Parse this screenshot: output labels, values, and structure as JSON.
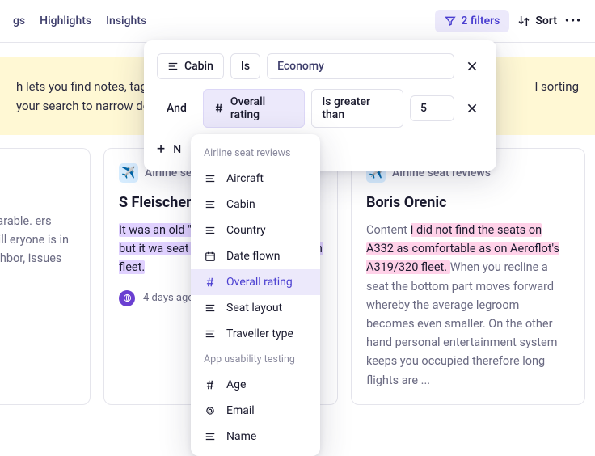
{
  "toolbar": {
    "tabs": [
      "gs",
      "Highlights",
      "Insights"
    ],
    "filters_label": "2 filters",
    "sort_label": "Sort"
  },
  "banner": {
    "line1": "h lets you find notes, tags,",
    "line2": "your search to narrow dow",
    "line3_suffix": "l sorting"
  },
  "filters": {
    "row1": {
      "field_label": "Cabin",
      "operator": "Is",
      "value": "Economy"
    },
    "row2": {
      "conj": "And",
      "field_label": "Overall rating",
      "operator": "Is greater than",
      "value": "5"
    },
    "new_filter_label": "N"
  },
  "dropdown": {
    "groups": [
      {
        "label": "Airline seat reviews",
        "items": [
          {
            "icon": "text",
            "label": "Aircraft"
          },
          {
            "icon": "text",
            "label": "Cabin"
          },
          {
            "icon": "text",
            "label": "Country"
          },
          {
            "icon": "date",
            "label": "Date flown"
          },
          {
            "icon": "number",
            "label": "Overall rating",
            "selected": true
          },
          {
            "icon": "text",
            "label": "Seat layout"
          },
          {
            "icon": "text",
            "label": "Traveller type"
          }
        ]
      },
      {
        "label": "App usability testing",
        "items": [
          {
            "icon": "number",
            "label": "Age"
          },
          {
            "icon": "email",
            "label": "Email"
          },
          {
            "icon": "text",
            "label": "Name"
          }
        ]
      }
    ]
  },
  "cards": [
    {
      "body": "but bearable. ers they will eryone is in ur neighbor, issues come",
      "footer_date": ""
    },
    {
      "project": "Airline sea",
      "title": "S Fleischer",
      "body": "It was an old \"c wasn't a slim s used but it wa seat for shorte mostly used th fleet.",
      "footer_date": "4 days ago"
    },
    {
      "project": "Airline seat reviews",
      "title": "Boris Orenic",
      "body_prefix": "Content ",
      "hl1": "I did not find the seats on",
      "hl2": "A332 as comfortable as on Aeroflot's A319/320 fleet. ",
      "body_suffix": "When you recline a seat the bottom part moves forward whereby the average legroom becomes even smaller. On the other hand personal entertainment system keeps you occupied therefore long flights are ... "
    }
  ]
}
